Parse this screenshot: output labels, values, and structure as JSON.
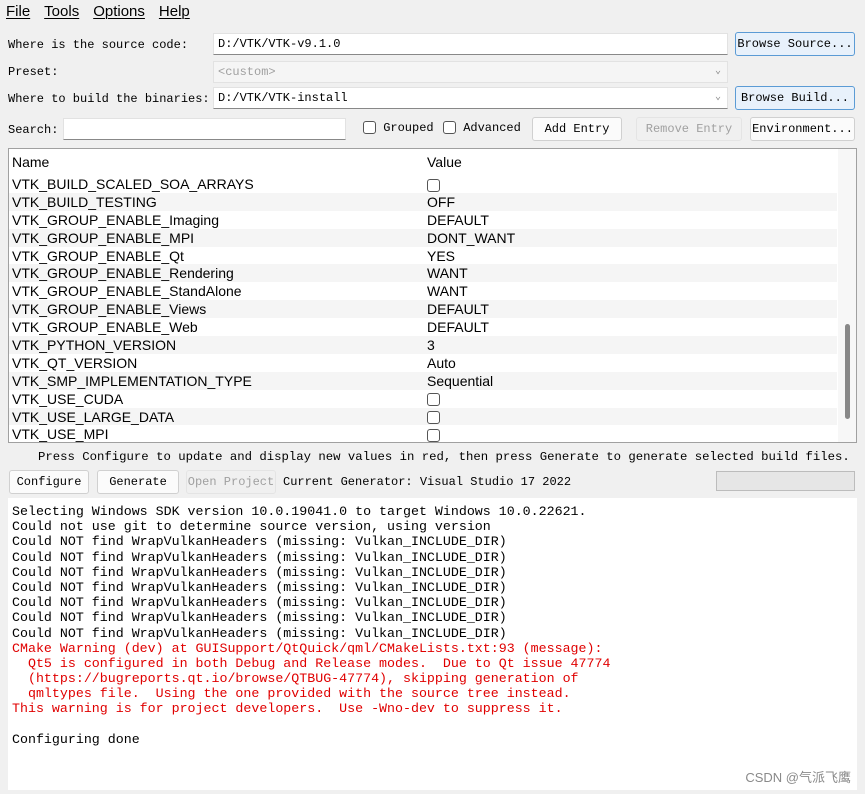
{
  "menu": [
    "File",
    "Tools",
    "Options",
    "Help"
  ],
  "source": {
    "label": "Where is the source code:",
    "value": "D:/VTK/VTK-v9.1.0",
    "button": "Browse Source..."
  },
  "preset": {
    "label": "Preset:",
    "value": "<custom>"
  },
  "build": {
    "label": "Where to build the binaries:",
    "value": "D:/VTK/VTK-install",
    "button": "Browse Build..."
  },
  "search": {
    "label": "Search:",
    "value": "",
    "grouped": "Grouped",
    "advanced": "Advanced",
    "add": "Add Entry",
    "remove": "Remove Entry",
    "env": "Environment..."
  },
  "table": {
    "headers": [
      "Name",
      "Value"
    ],
    "rows": [
      {
        "name": "VTK_BUILD_SCALED_SOA_ARRAYS",
        "value": "",
        "checkbox": true
      },
      {
        "name": "VTK_BUILD_TESTING",
        "value": "OFF"
      },
      {
        "name": "VTK_GROUP_ENABLE_Imaging",
        "value": "DEFAULT"
      },
      {
        "name": "VTK_GROUP_ENABLE_MPI",
        "value": "DONT_WANT"
      },
      {
        "name": "VTK_GROUP_ENABLE_Qt",
        "value": "YES"
      },
      {
        "name": "VTK_GROUP_ENABLE_Rendering",
        "value": "WANT"
      },
      {
        "name": "VTK_GROUP_ENABLE_StandAlone",
        "value": "WANT"
      },
      {
        "name": "VTK_GROUP_ENABLE_Views",
        "value": "DEFAULT"
      },
      {
        "name": "VTK_GROUP_ENABLE_Web",
        "value": "DEFAULT"
      },
      {
        "name": "VTK_PYTHON_VERSION",
        "value": "3"
      },
      {
        "name": "VTK_QT_VERSION",
        "value": "Auto"
      },
      {
        "name": "VTK_SMP_IMPLEMENTATION_TYPE",
        "value": "Sequential"
      },
      {
        "name": "VTK_USE_CUDA",
        "value": "",
        "checkbox": true
      },
      {
        "name": "VTK_USE_LARGE_DATA",
        "value": "",
        "checkbox": true
      },
      {
        "name": "VTK_USE_MPI",
        "value": "",
        "checkbox": true
      }
    ]
  },
  "hint": "Press Configure to update and display new values in red, then press Generate to generate selected build files.",
  "actions": {
    "configure": "Configure",
    "generate": "Generate",
    "open": "Open Project",
    "generator": "Current Generator: Visual Studio 17 2022"
  },
  "progress": 0,
  "log": [
    {
      "text": "Selecting Windows SDK version 10.0.19041.0 to target Windows 10.0.22621.",
      "red": false
    },
    {
      "text": "Could not use git to determine source version, using version",
      "red": false
    },
    {
      "text": "Could NOT find WrapVulkanHeaders (missing: Vulkan_INCLUDE_DIR)",
      "red": false
    },
    {
      "text": "Could NOT find WrapVulkanHeaders (missing: Vulkan_INCLUDE_DIR)",
      "red": false
    },
    {
      "text": "Could NOT find WrapVulkanHeaders (missing: Vulkan_INCLUDE_DIR)",
      "red": false
    },
    {
      "text": "Could NOT find WrapVulkanHeaders (missing: Vulkan_INCLUDE_DIR)",
      "red": false
    },
    {
      "text": "Could NOT find WrapVulkanHeaders (missing: Vulkan_INCLUDE_DIR)",
      "red": false
    },
    {
      "text": "Could NOT find WrapVulkanHeaders (missing: Vulkan_INCLUDE_DIR)",
      "red": false
    },
    {
      "text": "Could NOT find WrapVulkanHeaders (missing: Vulkan_INCLUDE_DIR)",
      "red": false
    },
    {
      "text": "CMake Warning (dev) at GUISupport/QtQuick/qml/CMakeLists.txt:93 (message):",
      "red": true
    },
    {
      "text": "  Qt5 is configured in both Debug and Release modes.  Due to Qt issue 47774",
      "red": true
    },
    {
      "text": "  (https://bugreports.qt.io/browse/QTBUG-47774), skipping generation of",
      "red": true
    },
    {
      "text": "  qmltypes file.  Using the one provided with the source tree instead.",
      "red": true
    },
    {
      "text": "This warning is for project developers.  Use -Wno-dev to suppress it.",
      "red": true
    },
    {
      "text": "",
      "red": false
    },
    {
      "text": "Configuring done",
      "red": false
    }
  ],
  "watermark": "CSDN @气派飞鹰"
}
